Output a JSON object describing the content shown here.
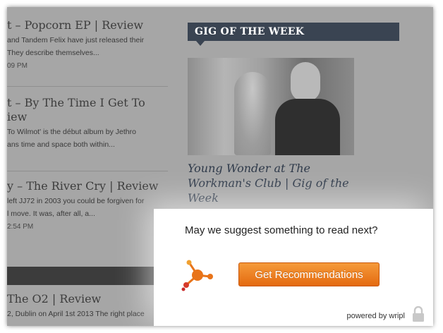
{
  "articles": [
    {
      "title": "t – Popcorn EP | Review",
      "excerpt_lines": [
        "and Tandem Felix have just released their",
        "They describe themselves..."
      ],
      "time": "09 PM"
    },
    {
      "title_lines": [
        "t – By The Time I Get To",
        "iew"
      ],
      "excerpt_lines": [
        "To Wilmot' is the début album by Jethro",
        "ans time and space both within..."
      ]
    },
    {
      "title": "y – The River Cry | Review",
      "excerpt_lines": [
        "left JJ72 in 2003 you could be forgiven for",
        "l move. It was, after all, a..."
      ],
      "time": "2:54 PM"
    },
    {
      "title": "The O2 | Review",
      "excerpt_lines": [
        "2, Dublin on April 1st 2013 The right place"
      ]
    }
  ],
  "gig": {
    "header": "GIG OF THE WEEK",
    "title": "Young Wonder at The Workman's Club | Gig of the Week"
  },
  "popup": {
    "question": "May we suggest something to read next?",
    "button_label": "Get Recommendations",
    "powered_by": "powered by wripl",
    "accent_color": "#e8741a",
    "icons": [
      "wripl-logo-icon",
      "lock-icon"
    ]
  }
}
